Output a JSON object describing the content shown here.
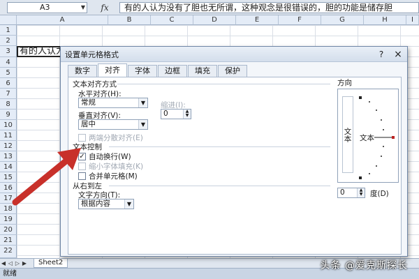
{
  "formula_bar": {
    "name_box": "A3",
    "fx_label": "fx",
    "content": "有的人认为没有了胆也无所谓，这种观念是很错误的，胆的功能是储存胆"
  },
  "columns": [
    "A",
    "B",
    "C",
    "D",
    "E",
    "F",
    "G",
    "H",
    "I"
  ],
  "rows": [
    "1",
    "2",
    "3",
    "4",
    "5",
    "6",
    "7",
    "8",
    "9",
    "10",
    "11",
    "12",
    "13",
    "14",
    "15",
    "16",
    "17",
    "18",
    "19",
    "20",
    "21",
    "22"
  ],
  "cell_a3": "有的人认为没有了胆也无所谓，这种观念是很错误的，胆的功能是储存胆汁",
  "sheet_tabs": {
    "tab_visible": "Sheet2"
  },
  "status_bar": {
    "text": "就绪"
  },
  "watermark": "头条 @爱克斯探长",
  "dialog": {
    "title": "设置单元格格式",
    "help": "?",
    "close": "×",
    "tabs": [
      "数字",
      "对齐",
      "字体",
      "边框",
      "填充",
      "保护"
    ],
    "active_tab": "对齐",
    "text_alignment": {
      "section": "文本对齐方式",
      "horizontal_label": "水平对齐(H):",
      "horizontal_value": "常规",
      "indent_label": "缩进(I):",
      "indent_value": "0",
      "vertical_label": "垂直对齐(V):",
      "vertical_value": "居中",
      "justify_distributed": "两端分散对齐(E)"
    },
    "text_control": {
      "section": "文本控制",
      "wrap_text": "自动换行(W)",
      "wrap_text_checked": true,
      "shrink_to_fit": "缩小字体填充(K)",
      "merge_cells": "合并单元格(M)"
    },
    "right_to_left": {
      "section": "从右到左",
      "direction_label": "文字方向(T):",
      "direction_value": "根据内容"
    },
    "orientation": {
      "label": "方向",
      "vertical_text": "文本",
      "horizontal_text": "文本",
      "degrees_value": "0",
      "degrees_label": "度(D)"
    }
  },
  "colors": {
    "annotation_arrow": "#c8302a",
    "header_bg": "#e4ecf7",
    "dialog_bg": "#f3f6fa"
  }
}
